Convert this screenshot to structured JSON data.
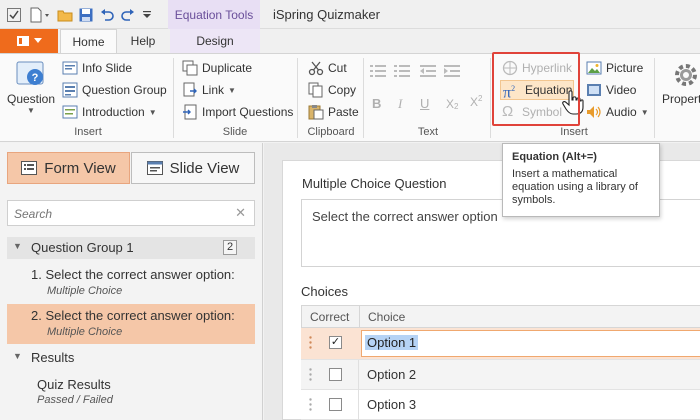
{
  "titlebar": {
    "context_tab": "Equation Tools",
    "app_title": "iSpring Quizmaker"
  },
  "tabs": {
    "home": "Home",
    "help": "Help",
    "design": "Design"
  },
  "ribbon": {
    "insert_group": {
      "label": "Insert",
      "question": "Question",
      "info_slide": "Info Slide",
      "question_group": "Question Group",
      "introduction": "Introduction"
    },
    "slide_group": {
      "label": "Slide",
      "duplicate": "Duplicate",
      "link": "Link",
      "import_questions": "Import Questions"
    },
    "clipboard_group": {
      "label": "Clipboard",
      "cut": "Cut",
      "copy": "Copy",
      "paste": "Paste"
    },
    "text_group": {
      "label": "Text"
    },
    "insert2_group": {
      "label": "Insert",
      "hyperlink": "Hyperlink",
      "equation": "Equation",
      "symbol": "Symbol",
      "picture": "Picture",
      "video": "Video",
      "audio": "Audio"
    },
    "properties": "Propert"
  },
  "tooltip": {
    "title": "Equation (Alt+=)",
    "body": "Insert a mathematical equation using a library of symbols."
  },
  "left_panel": {
    "form_view": "Form View",
    "slide_view": "Slide View",
    "search_placeholder": "Search",
    "group": {
      "label": "Question Group 1",
      "count": "2"
    },
    "questions": [
      {
        "title": "1.  Select the correct answer option:",
        "type": "Multiple Choice"
      },
      {
        "title": "2.  Select the correct answer option:",
        "type": "Multiple Choice"
      }
    ],
    "results": {
      "label": "Results",
      "item_title": "Quiz Results",
      "item_sub": "Passed / Failed"
    }
  },
  "main": {
    "question_type": "Multiple Choice Question",
    "question_text": "Select the correct answer option",
    "choices_label": "Choices",
    "col_correct": "Correct",
    "col_choice": "Choice",
    "choices": [
      {
        "text": "Option 1",
        "correct": "✓"
      },
      {
        "text": "Option 2",
        "correct": ""
      },
      {
        "text": "Option 3",
        "correct": ""
      }
    ]
  },
  "colors": {
    "accent_orange": "#ef6b1c",
    "selection_peach": "#f5c7a8",
    "context_purple": "#e8dff4",
    "highlight_red": "#e0433a"
  }
}
